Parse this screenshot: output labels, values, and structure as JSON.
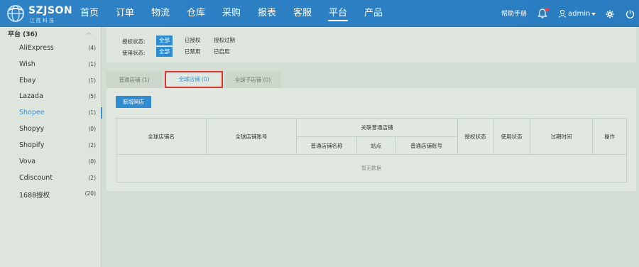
{
  "app": {
    "logo_title": "SZJSON",
    "logo_subtitle": "江胜科技"
  },
  "nav": {
    "items": [
      {
        "label": "首页"
      },
      {
        "label": "订单"
      },
      {
        "label": "物流"
      },
      {
        "label": "仓库"
      },
      {
        "label": "采购"
      },
      {
        "label": "报表"
      },
      {
        "label": "客服"
      },
      {
        "label": "平台",
        "active": true
      },
      {
        "label": "产品"
      }
    ],
    "help_label": "帮助手册",
    "user_name": "admin",
    "icons": [
      "bell-icon",
      "user-icon",
      "gear-icon",
      "power-icon"
    ],
    "accent_color": "#2f82c4",
    "notification_dot_color": "#ff3b3b"
  },
  "sidebar": {
    "title": "平台 (36)",
    "items": [
      {
        "label": "AliExpress",
        "count": "(4)"
      },
      {
        "label": "Wish",
        "count": "(1)"
      },
      {
        "label": "Ebay",
        "count": "(1)"
      },
      {
        "label": "Lazada",
        "count": "(5)"
      },
      {
        "label": "Shopee",
        "count": "(1)",
        "active": true
      },
      {
        "label": "Shopyy",
        "count": "(0)"
      },
      {
        "label": "Shopify",
        "count": "(2)"
      },
      {
        "label": "Vova",
        "count": "(0)"
      },
      {
        "label": "Cdiscount",
        "count": "(2)"
      },
      {
        "label": "1688授权",
        "count": "(20)"
      }
    ]
  },
  "filters": {
    "auth_status": {
      "label": "授权状态:",
      "options": [
        "全部",
        "已授权",
        "授权过期"
      ],
      "selected": "全部"
    },
    "use_status": {
      "label": "使用状态:",
      "options": [
        "全部",
        "已禁用",
        "已启用"
      ],
      "selected": "全部"
    }
  },
  "tabs": [
    {
      "label": "普通店铺 (1)"
    },
    {
      "label": "全球店铺 (0)",
      "active": true
    },
    {
      "label": "全球子店铺 (0)"
    }
  ],
  "toolbar": {
    "add_store_label": "新增网店"
  },
  "table": {
    "columns": {
      "global_store_name": "全球店铺名",
      "global_store_account": "全球店铺账号",
      "linked_group": "关联普通店铺",
      "linked_name": "普通店铺名称",
      "linked_site": "站点",
      "linked_account": "普通店铺账号",
      "auth_status": "授权状态",
      "use_status": "使用状态",
      "expire_time": "过期时间",
      "actions": "操作"
    },
    "empty_text": "暂无数据"
  }
}
